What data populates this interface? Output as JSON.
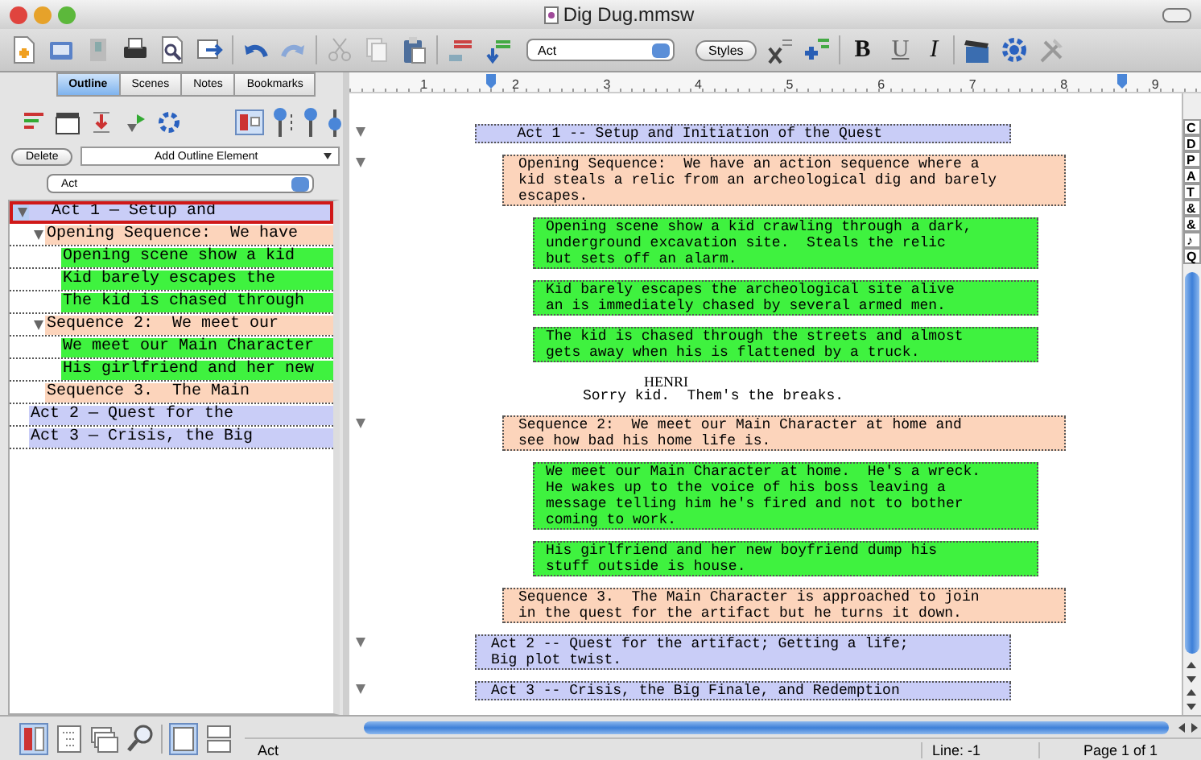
{
  "window": {
    "title": "Dig Dug.mmsw"
  },
  "toolbar": {
    "element_select": {
      "value": "Act"
    },
    "styles_button": "Styles",
    "format_buttons": [
      {
        "label": "B",
        "kind": "bold"
      },
      {
        "label": "U",
        "kind": "underline"
      },
      {
        "label": "I",
        "kind": "italic"
      }
    ]
  },
  "sidebar": {
    "tabs": [
      {
        "label": "Outline",
        "selected": true
      },
      {
        "label": "Scenes",
        "selected": false
      },
      {
        "label": "Notes",
        "selected": false
      },
      {
        "label": "Bookmarks",
        "selected": false
      }
    ],
    "delete_button": "Delete",
    "add_element": {
      "value": "Add Outline Element"
    },
    "element_filter": {
      "value": "Act"
    },
    "outline": [
      {
        "kind": "act",
        "text": "Act 1 — Setup and",
        "selected": true,
        "expanded": true,
        "children": [
          {
            "kind": "sequence",
            "text": "Opening Sequence:  We have",
            "selected": false,
            "expanded": true,
            "children": [
              {
                "kind": "scene",
                "text": "Opening scene show a kid",
                "selected": false
              },
              {
                "kind": "scene",
                "text": "Kid barely escapes the",
                "selected": false
              },
              {
                "kind": "scene",
                "text": "The kid is chased through",
                "selected": false
              }
            ]
          },
          {
            "kind": "sequence",
            "text": "Sequence 2:  We meet our",
            "selected": false,
            "expanded": true,
            "children": [
              {
                "kind": "scene",
                "text": "We meet our Main Character",
                "selected": false
              },
              {
                "kind": "scene",
                "text": "His girlfriend and her new",
                "selected": false
              }
            ]
          },
          {
            "kind": "sequence",
            "text": "Sequence 3.  The Main",
            "selected": false
          }
        ]
      },
      {
        "kind": "act",
        "text": "Act 2 — Quest for the",
        "selected": false
      },
      {
        "kind": "act",
        "text": "Act 3 — Crisis, the Big",
        "selected": false
      }
    ]
  },
  "ruler": [
    "1",
    "2",
    "3",
    "4",
    "5",
    "6",
    "7",
    "8",
    "9"
  ],
  "document": {
    "blocks": [
      {
        "kind": "act",
        "triangle": true,
        "text": "   Act 1 -- Setup and Initiation of the Quest"
      },
      {
        "kind": "sequence",
        "triangle": true,
        "text": "Opening Sequence:  We have an action sequence where a\nkid steals a relic from an archeological dig and barely\nescapes."
      },
      {
        "kind": "scene",
        "triangle": false,
        "text": "Opening scene show a kid crawling through a dark,\nunderground excavation site.  Steals the relic\nbut sets off an alarm."
      },
      {
        "kind": "scene",
        "triangle": false,
        "text": "Kid barely escapes the archeological site alive\nan is immediately chased by several armed men."
      },
      {
        "kind": "scene",
        "triangle": false,
        "text": "The kid is chased through the streets and almost\ngets away when his is flattened by a truck."
      },
      {
        "kind": "character",
        "triangle": false,
        "text": "HENRI"
      },
      {
        "kind": "dialogue",
        "triangle": false,
        "text": "Sorry kid.  Them's the breaks."
      },
      {
        "kind": "sequence",
        "triangle": true,
        "text": "Sequence 2:  We meet our Main Character at home and\nsee how bad his home life is."
      },
      {
        "kind": "scene",
        "triangle": false,
        "text": "We meet our Main Character at home.  He's a wreck.\nHe wakes up to the voice of his boss leaving a\nmessage telling him he's fired and not to bother\ncoming to work."
      },
      {
        "kind": "scene",
        "triangle": false,
        "text": "His girlfriend and her new boyfriend dump his\nstuff outside is house."
      },
      {
        "kind": "sequence",
        "triangle": false,
        "text": "Sequence 3.  The Main Character is approached to join\nin the quest for the artifact but he turns it down."
      },
      {
        "kind": "act",
        "triangle": true,
        "text": "Act 2 -- Quest for the artifact; Getting a life;\nBig plot twist."
      },
      {
        "kind": "act",
        "triangle": true,
        "text": "Act 3 -- Crisis, the Big Finale, and Redemption"
      }
    ]
  },
  "element_buttons": [
    "C",
    "D",
    "P",
    "A",
    "T",
    "&",
    "&",
    "♪",
    "Q"
  ],
  "status_bar": {
    "element": "Act",
    "line": "Line:  -1",
    "page": "Page 1 of 1"
  }
}
